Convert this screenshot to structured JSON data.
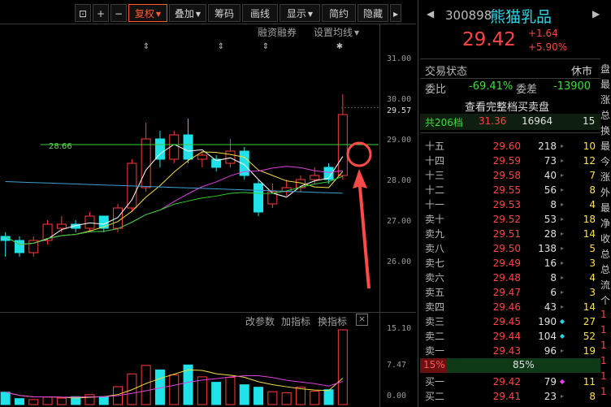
{
  "toolbar": {
    "buttons": [
      "复权",
      "叠加",
      "筹码",
      "画线",
      "显示",
      "简约",
      "隐藏"
    ],
    "more": "▸"
  },
  "chart_subbar": {
    "financing": "融资融券",
    "ma_setting": "设置均线"
  },
  "indicator_bar": {
    "params": "改参数",
    "add": "加指标",
    "switch": "换指标",
    "close": "×"
  },
  "price_axis": [
    "31.00",
    "30.00",
    "29.57",
    "29.00",
    "28.00",
    "27.00",
    "26.00"
  ],
  "volume_axis": [
    "15.10",
    "7.47",
    "0.00"
  ],
  "chart_annotation": "28.66",
  "chart_data": {
    "type": "candlestick",
    "candles": [
      {
        "o": 26.3,
        "c": 26.4,
        "h": 26.5,
        "l": 25.9,
        "up": false
      },
      {
        "o": 26.3,
        "c": 26.0,
        "h": 26.4,
        "l": 25.9,
        "up": false
      },
      {
        "o": 26.0,
        "c": 26.3,
        "h": 26.4,
        "l": 25.9,
        "up": true
      },
      {
        "o": 26.3,
        "c": 26.7,
        "h": 26.8,
        "l": 26.2,
        "up": true
      },
      {
        "o": 26.6,
        "c": 26.7,
        "h": 26.9,
        "l": 26.5,
        "up": true
      },
      {
        "o": 26.7,
        "c": 26.6,
        "h": 26.8,
        "l": 26.5,
        "up": false
      },
      {
        "o": 26.6,
        "c": 26.9,
        "h": 27.0,
        "l": 26.5,
        "up": true
      },
      {
        "o": 26.9,
        "c": 26.6,
        "h": 26.9,
        "l": 26.5,
        "up": false
      },
      {
        "o": 26.6,
        "c": 27.1,
        "h": 27.2,
        "l": 26.5,
        "up": true
      },
      {
        "o": 27.1,
        "c": 28.2,
        "h": 28.3,
        "l": 27.0,
        "up": true
      },
      {
        "o": 27.6,
        "c": 28.8,
        "h": 29.2,
        "l": 27.5,
        "up": true
      },
      {
        "o": 28.8,
        "c": 28.3,
        "h": 29.0,
        "l": 28.1,
        "up": false
      },
      {
        "o": 28.3,
        "c": 28.9,
        "h": 29.0,
        "l": 28.2,
        "up": true
      },
      {
        "o": 28.9,
        "c": 28.3,
        "h": 29.3,
        "l": 28.2,
        "up": false
      },
      {
        "o": 28.3,
        "c": 28.4,
        "h": 28.5,
        "l": 28.1,
        "up": true
      },
      {
        "o": 28.3,
        "c": 28.1,
        "h": 28.4,
        "l": 28.0,
        "up": false
      },
      {
        "o": 28.2,
        "c": 28.5,
        "h": 28.8,
        "l": 28.1,
        "up": true
      },
      {
        "o": 28.5,
        "c": 27.9,
        "h": 28.6,
        "l": 27.8,
        "up": false
      },
      {
        "o": 27.7,
        "c": 27.0,
        "h": 27.8,
        "l": 26.9,
        "up": false
      },
      {
        "o": 27.2,
        "c": 27.5,
        "h": 27.7,
        "l": 27.1,
        "up": true
      },
      {
        "o": 27.5,
        "c": 27.6,
        "h": 27.8,
        "l": 27.4,
        "up": true
      },
      {
        "o": 27.6,
        "c": 27.8,
        "h": 27.9,
        "l": 27.5,
        "up": true
      },
      {
        "o": 27.8,
        "c": 27.9,
        "h": 28.1,
        "l": 27.7,
        "up": true
      },
      {
        "o": 28.1,
        "c": 27.8,
        "h": 28.2,
        "l": 27.7,
        "up": false
      },
      {
        "o": 27.9,
        "c": 29.4,
        "h": 29.9,
        "l": 27.8,
        "up": true
      }
    ],
    "volumes": [
      2.5,
      1.2,
      1.0,
      1.5,
      1.3,
      1.6,
      2.0,
      1.6,
      3.6,
      6.2,
      7.9,
      7.0,
      6.0,
      8.0,
      5.6,
      4.5,
      5.5,
      4.0,
      3.5,
      2.6,
      2.4,
      3.5,
      2.7,
      3.0,
      15.1
    ],
    "ylim": [
      25.5,
      31.3
    ],
    "vol_ylim": [
      0,
      15.1
    ]
  },
  "quote": {
    "code": "300898",
    "name": "熊猫乳品",
    "price": "29.42",
    "change": "+1.64",
    "pct": "+5.90%",
    "status_label": "交易状态",
    "status_value": "休市",
    "weibi_label": "委比",
    "weibi_value": "-69.41%",
    "weicha_label": "委差",
    "weicha_value": "-13900",
    "full_book": "查看完整档买卖盘",
    "total_levels": "共206档",
    "total_price": "31.36",
    "total_vol": "16964",
    "total_cnt": "15"
  },
  "sell_rows": [
    {
      "label": "十五",
      "price": "29.60",
      "vol": "218",
      "cnt": "10"
    },
    {
      "label": "十四",
      "price": "29.59",
      "vol": "73",
      "cnt": "12"
    },
    {
      "label": "十三",
      "price": "29.58",
      "vol": "40",
      "cnt": "7"
    },
    {
      "label": "十二",
      "price": "29.55",
      "vol": "56",
      "cnt": "8"
    },
    {
      "label": "十一",
      "price": "29.53",
      "vol": "8",
      "cnt": "4"
    },
    {
      "label": "卖十",
      "price": "29.52",
      "vol": "53",
      "cnt": "18"
    },
    {
      "label": "卖九",
      "price": "29.51",
      "vol": "28",
      "cnt": "14"
    },
    {
      "label": "卖八",
      "price": "29.50",
      "vol": "138",
      "cnt": "5"
    },
    {
      "label": "卖七",
      "price": "29.49",
      "vol": "16",
      "cnt": "3"
    },
    {
      "label": "卖六",
      "price": "29.48",
      "vol": "8",
      "cnt": "4"
    },
    {
      "label": "卖五",
      "price": "29.47",
      "vol": "6",
      "cnt": "3"
    },
    {
      "label": "卖四",
      "price": "29.46",
      "vol": "43",
      "cnt": "14"
    },
    {
      "label": "卖三",
      "price": "29.45",
      "vol": "190",
      "cnt": "27",
      "mark": "◆"
    },
    {
      "label": "卖二",
      "price": "29.44",
      "vol": "104",
      "cnt": "52",
      "mark": "◆"
    },
    {
      "label": "卖一",
      "price": "29.43",
      "vol": "96",
      "cnt": "19"
    }
  ],
  "ratio": {
    "buy": "15%",
    "sell": "85%"
  },
  "buy_rows": [
    {
      "label": "买一",
      "price": "29.42",
      "vol": "79",
      "cnt": "11",
      "mark": "◆"
    },
    {
      "label": "买二",
      "price": "29.41",
      "vol": "23",
      "cnt": "8"
    }
  ],
  "edge_chars": [
    "盘",
    "最",
    "涨",
    "总",
    "换",
    "最",
    "今",
    "涨",
    "外",
    "最",
    "净",
    "收",
    "总",
    "总",
    "流",
    "个",
    "1",
    "1",
    "1",
    "1",
    "1",
    "1"
  ],
  "colors": {
    "up": "#ff3b3b",
    "down": "#1fe3e8",
    "ma1": "#ffffff",
    "ma2": "#f0e040",
    "ma3": "#e040e0",
    "ma4": "#30d030",
    "ma5": "#3aa0d0"
  }
}
